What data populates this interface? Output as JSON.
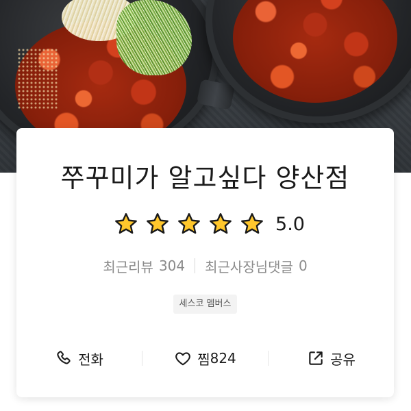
{
  "store": {
    "name": "쭈꾸미가 알고싶다 양산점",
    "rating": "5.0",
    "stars_filled": 5,
    "stars_total": 5,
    "colors": {
      "star_fill": "#FFC72C",
      "star_outline": "#1a1a1a",
      "text_primary": "#1a1a1a",
      "text_secondary": "#8b8b8b"
    }
  },
  "reviews": {
    "recent_review_label": "최근리뷰",
    "recent_review_count": "304",
    "owner_comment_label": "최근사장님댓글",
    "owner_comment_count": "0"
  },
  "badge": {
    "label": "세스코 멤버스"
  },
  "actions": [
    {
      "label": "전화",
      "icon": "phone-icon"
    },
    {
      "label": "찜",
      "count": "824",
      "icon": "heart-icon"
    },
    {
      "label": "공유",
      "icon": "share-icon"
    }
  ]
}
